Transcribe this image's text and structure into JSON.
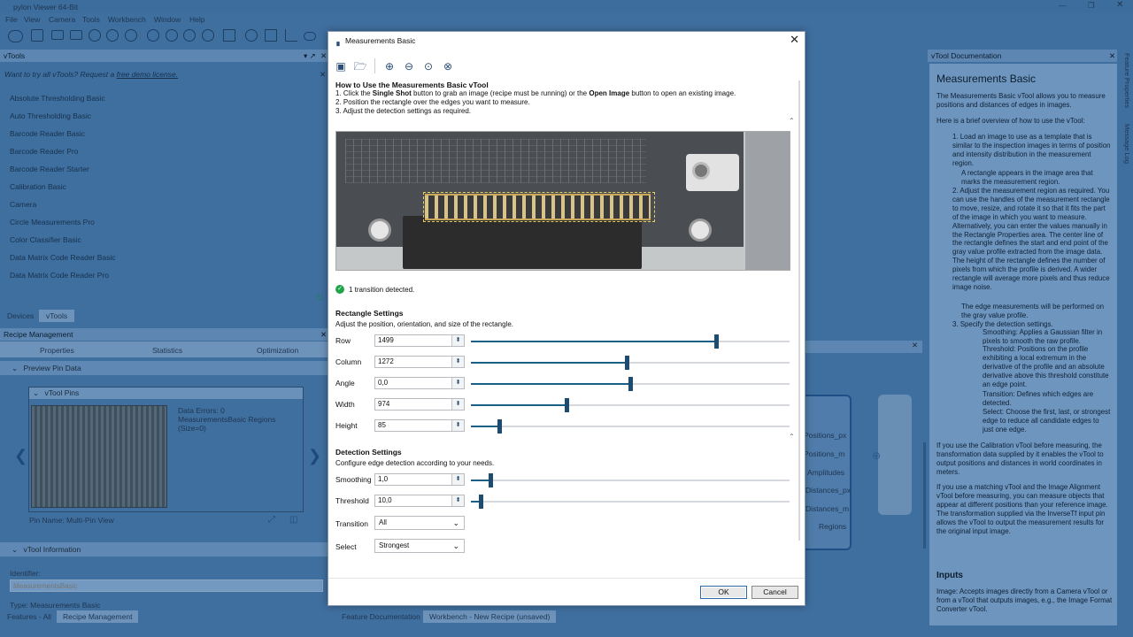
{
  "app": {
    "title": "pylon Viewer 64-Bit",
    "menu": [
      "File",
      "View",
      "Camera",
      "Tools",
      "Workbench",
      "Window",
      "Help"
    ]
  },
  "vtools": {
    "title": "vTools",
    "demo_text": "Want to try all vTools? Request a ",
    "demo_link": "free demo license.",
    "items": [
      "Absolute Thresholding Basic",
      "Auto Thresholding Basic",
      "Barcode Reader Basic",
      "Barcode Reader Pro",
      "Barcode Reader Starter",
      "Calibration Basic",
      "Camera",
      "Circle Measurements Pro",
      "Color Classifier Basic",
      "Data Matrix Code Reader Basic",
      "Data Matrix Code Reader Pro"
    ]
  },
  "bottom_tabs": [
    "Devices",
    "vTools"
  ],
  "recipe": {
    "title": "Recipe Management",
    "tabs": [
      "Properties",
      "Statistics",
      "Optimization"
    ],
    "preview": "Preview Pin Data",
    "pins_title": "vTool Pins",
    "data_errors": "Data Errors: 0",
    "regions": "MeasurementsBasic Regions (Size=0)",
    "pin_name": "Pin Name:  Multi-Pin View",
    "info_title": "vTool Information",
    "identifier_label": "Identifier:",
    "identifier_placeholder": "MeasurementsBasic",
    "type": "Type: Measurements Basic",
    "tabs_bottom": [
      "Features - All",
      "Recipe Management"
    ]
  },
  "dialog": {
    "title": "Measurements Basic",
    "help_title": "How to Use the Measurements Basic vTool",
    "step1_a": "1. Click the ",
    "step1_b": "Single Shot",
    "step1_c": " button to grab an image (recipe must be running) or the ",
    "step1_d": "Open Image",
    "step1_e": " button to open an existing image.",
    "step2": "2. Position the rectangle over the edges you want to measure.",
    "step3": "3. Adjust the detection settings as required.",
    "status": "1 transition detected.",
    "rect_title": "Rectangle Settings",
    "rect_sub": "Adjust the position, orientation, and size of the rectangle.",
    "rect_fields": [
      {
        "label": "Row",
        "value": "1499",
        "pos": 0.77
      },
      {
        "label": "Column",
        "value": "1272",
        "pos": 0.49
      },
      {
        "label": "Angle",
        "value": "0,0",
        "pos": 0.5
      },
      {
        "label": "Width",
        "value": "974",
        "pos": 0.3
      },
      {
        "label": "Height",
        "value": "85",
        "pos": 0.09
      }
    ],
    "det_title": "Detection Settings",
    "det_sub": "Configure edge detection according to your needs.",
    "det_fields": [
      {
        "label": "Smoothing",
        "value": "1,0",
        "pos": 0.06
      },
      {
        "label": "Threshold",
        "value": "10,0",
        "pos": 0.03
      }
    ],
    "transition_label": "Transition",
    "transition_value": "All",
    "select_label": "Select",
    "select_value": "Strongest",
    "ok": "OK",
    "cancel": "Cancel"
  },
  "workbench_tabs": [
    "Feature Documentation",
    "Workbench - New Recipe (unsaved)"
  ],
  "graph_pins": [
    "Positions_px",
    "Positions_m",
    "Amplitudes",
    "Distances_px",
    "Distances_m",
    "Regions"
  ],
  "doc": {
    "title": "vTool Documentation",
    "heading": "Measurements Basic",
    "intro": "The Measurements Basic vTool allows you to measure positions and distances of edges in images.",
    "overview": "Here is a brief overview of how to use the vTool:",
    "s1": "1. Load an image to use as a template that is similar to the inspection images in terms of position and intensity distribution in the measurement region.",
    "s1b": "A rectangle appears in the image area that marks the measurement region.",
    "s2": "2. Adjust the measurement region as required. You can use the handles of the measurement rectangle to move, resize, and rotate it so that it fits the part of the image in which you want to measure. Alternatively, you can enter the values manually in the Rectangle Properties area. The center line of the rectangle defines the start and end point of the gray value profile extracted from the image data. The height of the rectangle defines the number of pixels from which the profile is derived. A wider rectangle will average more pixels and thus reduce image noise.",
    "s2b": "The edge measurements will be performed on the gray value profile.",
    "s3": "3. Specify the detection settings.",
    "b1": "Smoothing: Applies a Gaussian filter in pixels to smooth the raw profile.",
    "b2": "Threshold: Positions on the profile exhibiting a local extremum in the derivative of the profile and an absolute derivative above this threshold constitute an edge point.",
    "b3": "Transition: Defines which edges are detected.",
    "b4": "Select: Choose the first, last, or strongest edge to reduce all candidate edges to just one edge.",
    "p1": "If you use the Calibration vTool before measuring, the transformation data supplied by it enables the vTool to output positions and distances in world coordinates in meters.",
    "p2": "If you use a matching vTool and the Image Alignment vTool before measuring, you can measure objects that appear at different positions than your reference image. The transformation supplied via the InverseTf input pin allows the vTool to output the measurement results for the original input image.",
    "inputs_title": "Inputs",
    "inputs_text": "Image: Accepts images directly from a Camera vTool or from a vTool that outputs images, e.g., the Image Format Converter vTool.",
    "side_tabs": [
      "Feature Properties",
      "Message Log"
    ]
  }
}
